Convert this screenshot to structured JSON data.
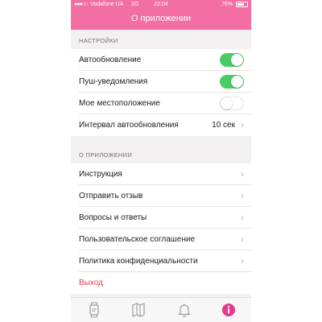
{
  "status": {
    "carrier": "Vodafone UA",
    "network": "3G",
    "time": "22:04",
    "battery": "76%",
    "battery_level": 0.76,
    "signal_dots": "●●●○○"
  },
  "header": {
    "title": "О приложении"
  },
  "settings": {
    "section_title": "НАСТРОЙКИ",
    "items": [
      {
        "label": "Автообновление",
        "control": "toggle",
        "on": true
      },
      {
        "label": "Пуш-уведомления",
        "control": "toggle",
        "on": true
      },
      {
        "label": "Мое местоположение",
        "control": "toggle",
        "on": false
      },
      {
        "label": "Интервал автообновления",
        "control": "disclosure",
        "value": "10 сек"
      }
    ]
  },
  "about": {
    "section_title": "О ПРИЛОЖЕНИИ",
    "items": [
      {
        "label": "Инструкция"
      },
      {
        "label": "Отправить отзыв"
      },
      {
        "label": "Вопросы и ответы"
      },
      {
        "label": "Пользовательское соглашение"
      },
      {
        "label": "Политика конфиденциальности"
      }
    ],
    "logout_label": "Выход"
  },
  "tabbar": {
    "tabs": [
      {
        "icon": "watch-icon",
        "active": false
      },
      {
        "icon": "map-icon",
        "active": false
      },
      {
        "icon": "bell-icon",
        "active": false
      },
      {
        "icon": "info-icon",
        "active": true
      }
    ]
  },
  "colors": {
    "accent": "#f26ea3",
    "toggle_on": "#4bcb64",
    "logout": "#e63b53"
  }
}
